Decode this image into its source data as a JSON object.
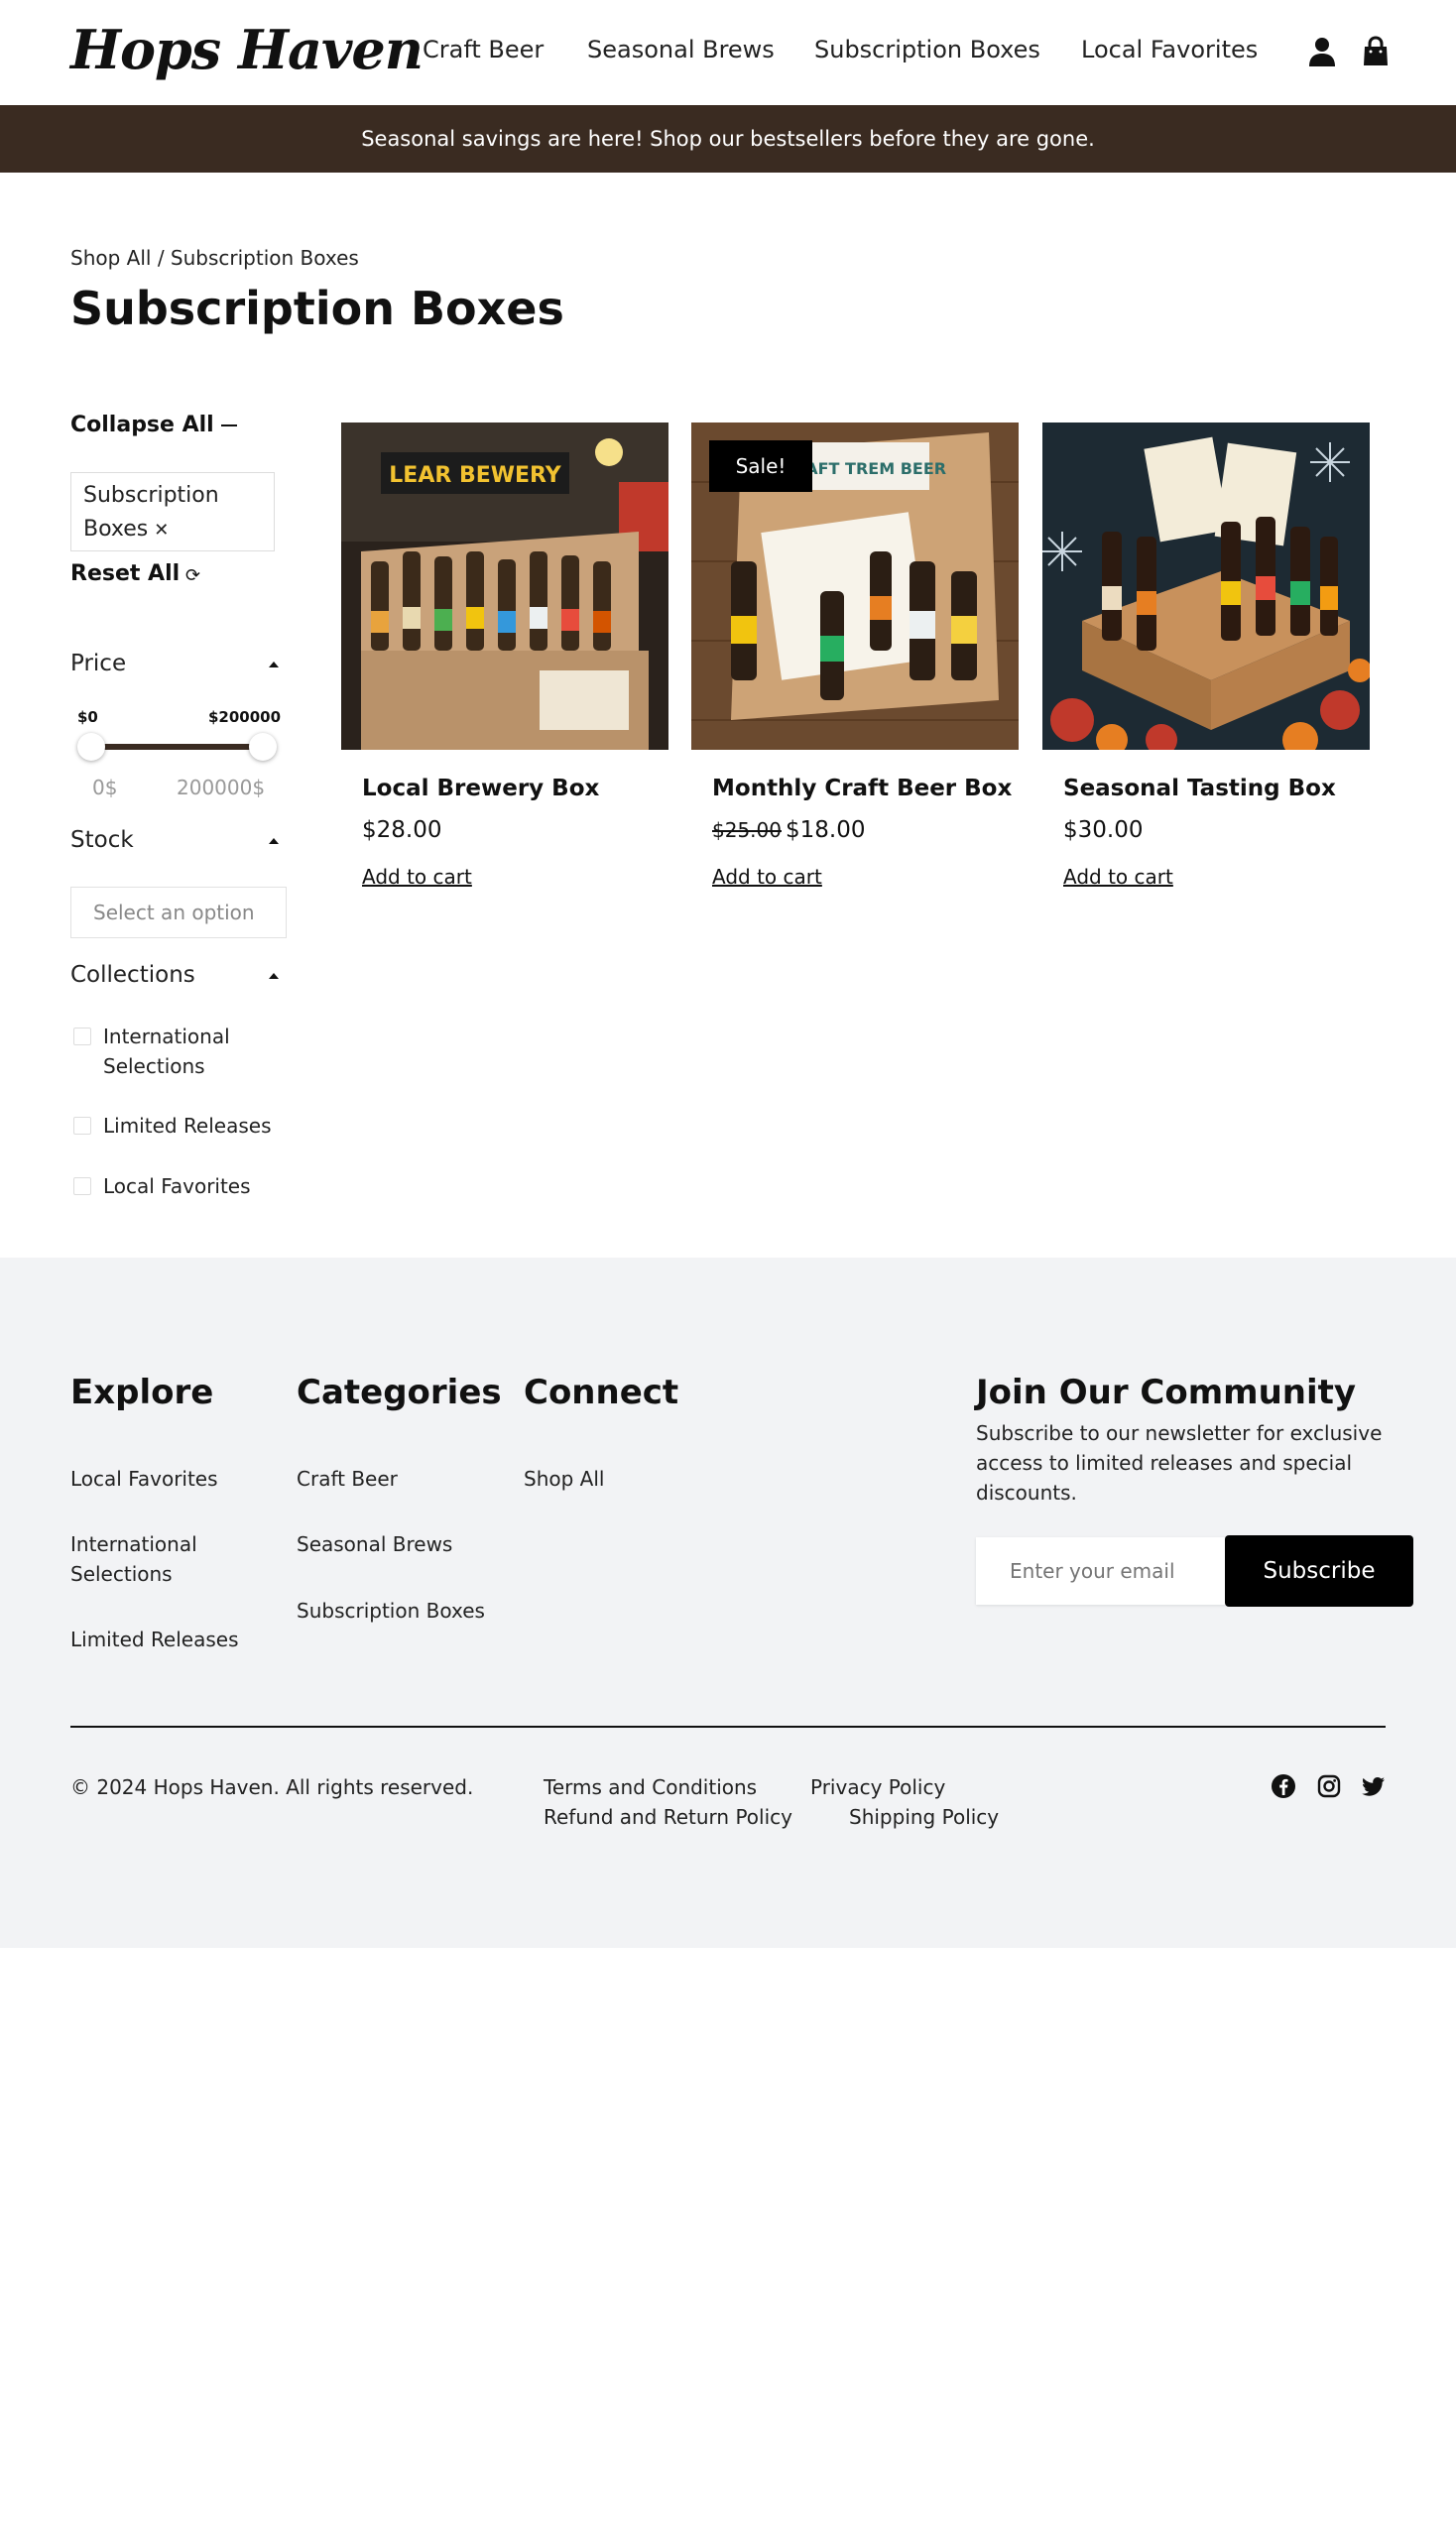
{
  "header": {
    "logo": "Hops Haven",
    "nav": [
      "Craft Beer",
      "Seasonal Brews",
      "Subscription Boxes",
      "Local Favorites"
    ]
  },
  "banner": {
    "text": "Seasonal savings are here! Shop our bestsellers before they are gone."
  },
  "breadcrumb": "Shop All / Subscription Boxes",
  "page_title": "Subscription Boxes",
  "sidebar": {
    "collapse_all": "Collapse All",
    "active_filter": "Subscription Boxes",
    "reset_all": "Reset All",
    "price": {
      "title": "Price",
      "min_label": "$0",
      "max_label": "$200000",
      "min_value": "0$",
      "max_value": "200000$"
    },
    "stock": {
      "title": "Stock",
      "placeholder": "Select an option"
    },
    "collections": {
      "title": "Collections",
      "items": [
        "International Selections",
        "Limited Releases",
        "Local Favorites"
      ]
    }
  },
  "products": [
    {
      "name": "Local Brewery Box",
      "price": "$28.00",
      "old_price": "",
      "badge": "",
      "cta": "Add to cart",
      "img_text": "LEAR BEWERY"
    },
    {
      "name": "Monthly Craft Beer Box",
      "price": "$18.00",
      "old_price": "$25.00",
      "badge": "Sale!",
      "cta": "Add to cart",
      "img_text": "RAFT TREM BEER"
    },
    {
      "name": "Seasonal Tasting Box",
      "price": "$30.00",
      "old_price": "",
      "badge": "",
      "cta": "Add to cart",
      "img_text": ""
    }
  ],
  "footer": {
    "explore": {
      "title": "Explore",
      "links": [
        "Local Favorites",
        "International Selections",
        "Limited Releases"
      ]
    },
    "categories": {
      "title": "Categories",
      "links": [
        "Craft Beer",
        "Seasonal Brews",
        "Subscription Boxes"
      ]
    },
    "connect": {
      "title": "Connect",
      "links": [
        "Shop All"
      ]
    },
    "community": {
      "title": "Join Our Community",
      "text": "Subscribe to our newsletter for exclusive access to limited releases and special discounts.",
      "email_placeholder": "Enter your email",
      "button": "Subscribe"
    },
    "copyright": "© 2024 Hops Haven. All rights reserved.",
    "legal": [
      "Terms and Conditions",
      "Privacy Policy",
      "Refund and Return Policy",
      "Shipping Policy"
    ],
    "social": [
      "facebook-icon",
      "instagram-icon",
      "twitter-icon"
    ]
  },
  "colors": {
    "banner_bg": "#3a2b21",
    "footer_bg": "#f2f3f5",
    "accent": "#000000"
  }
}
